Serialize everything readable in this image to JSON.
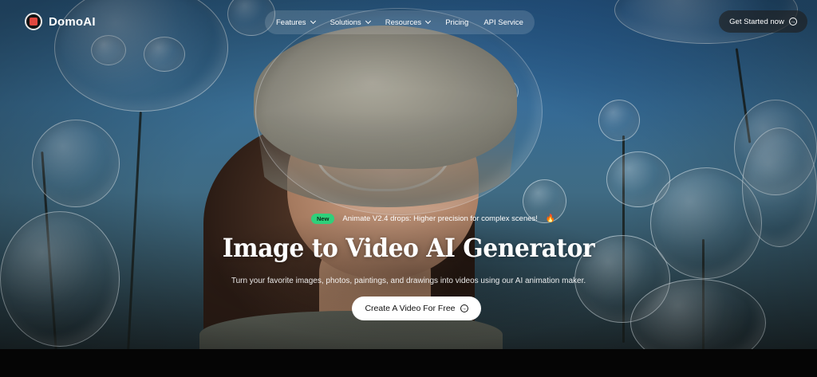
{
  "brand": {
    "name": "DomoAI"
  },
  "nav": {
    "items": [
      {
        "label": "Features",
        "has_dropdown": true
      },
      {
        "label": "Solutions",
        "has_dropdown": true
      },
      {
        "label": "Resources",
        "has_dropdown": true
      },
      {
        "label": "Pricing",
        "has_dropdown": false
      },
      {
        "label": "API Service",
        "has_dropdown": false
      }
    ],
    "cta_label": "Get Started now"
  },
  "hero": {
    "badge": "New",
    "announcement": "Animate V2.4 drops: Higher precision for complex scenes!",
    "title": "Image to Video AI Generator",
    "subtitle": "Turn your favorite images, photos, paintings, and drawings into videos using our AI animation maker.",
    "cta_label": "Create A Video For Free"
  },
  "colors": {
    "badge": "#2fd07a",
    "logo_accent": "#e2483f",
    "cta_bg": "#ffffff"
  },
  "icons": {
    "logo": "domoai-logo-icon",
    "arrow": "arrow-right-circle-icon",
    "chevron": "chevron-down-icon",
    "fire": "fire-icon"
  }
}
